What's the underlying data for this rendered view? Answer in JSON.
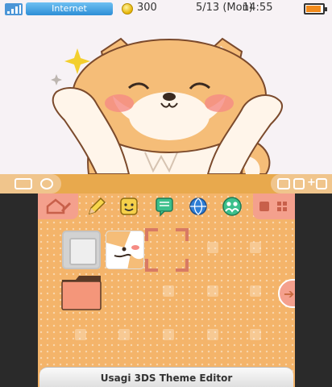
{
  "status_bar": {
    "connection_label": "Internet",
    "coin_count": "300",
    "date": "5/13 (Mon)",
    "time": "14:55",
    "battery_level": 0.9,
    "connection_color": "#4c96d7"
  },
  "mid_bar": {
    "left_icons": [
      "camera-icon",
      "y-button-icon"
    ],
    "right_icons": [
      "camera-icon",
      "l-button-icon",
      "plus-icon",
      "r-button-icon"
    ]
  },
  "toolbar": {
    "icons": [
      "home-settings-icon",
      "pencil-icon",
      "mii-face-icon",
      "notes-icon",
      "internet-globe-icon",
      "friends-icon"
    ],
    "right_icons": [
      "icon-size-large-icon",
      "icon-size-small-icon"
    ]
  },
  "colors": {
    "accent": "#f4a08d",
    "background": "#f4b46a",
    "mid_bar": "#e8a94d"
  },
  "footer": {
    "title": "Usagi 3DS Theme Editor"
  }
}
